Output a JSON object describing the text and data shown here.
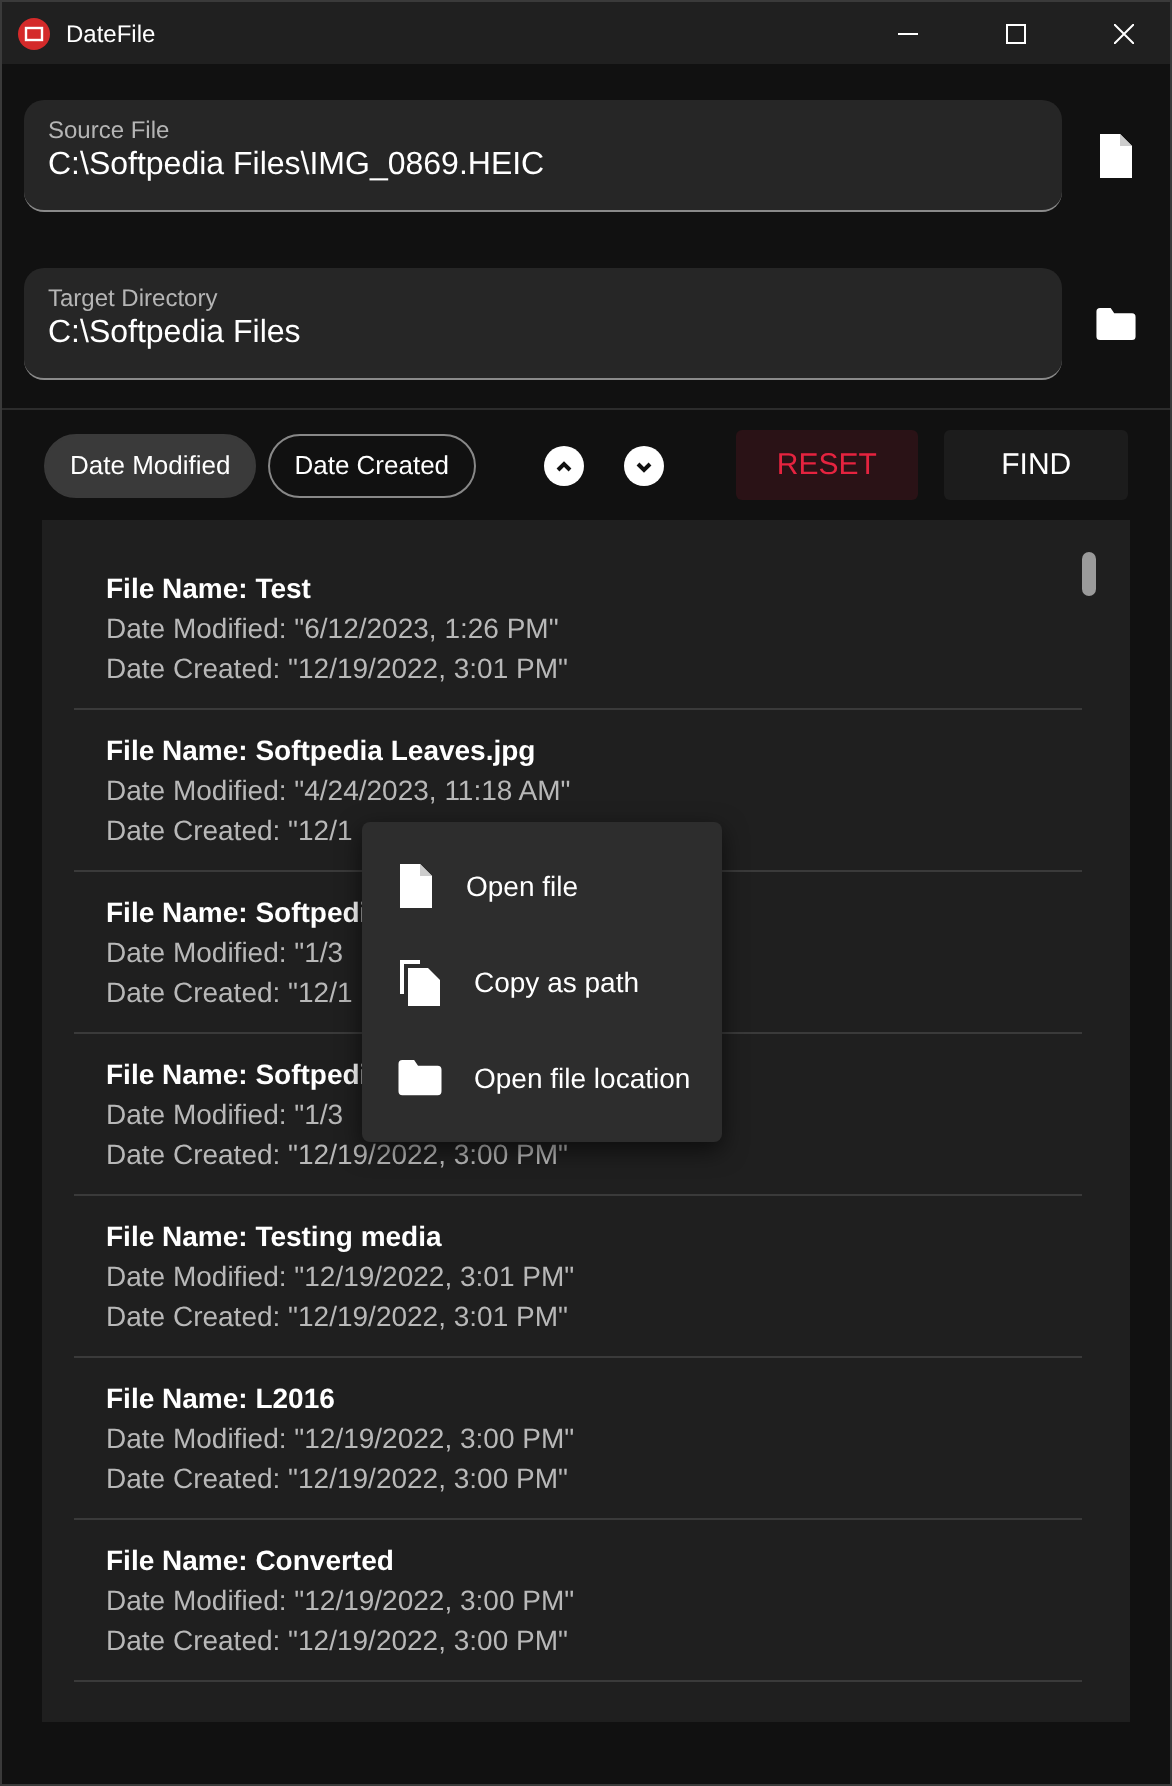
{
  "window": {
    "title": "DateFile"
  },
  "source": {
    "label": "Source File",
    "value": "C:\\Softpedia Files\\IMG_0869.HEIC"
  },
  "target": {
    "label": "Target Directory",
    "value": "C:\\Softpedia Files"
  },
  "sort_chips": [
    {
      "label": "Date Modified",
      "selected": true
    },
    {
      "label": "Date Created",
      "selected": false
    }
  ],
  "buttons": {
    "reset": "RESET",
    "find": "FIND"
  },
  "files": [
    {
      "name": "File Name: Test",
      "modified": "Date Modified: \"6/12/2023, 1:26 PM\"",
      "created": "Date Created: \"12/19/2022, 3:01 PM\""
    },
    {
      "name": "File Name: Softpedia Leaves.jpg",
      "modified": "Date Modified: \"4/24/2023, 11:18 AM\"",
      "created": "Date Created: \"12/1"
    },
    {
      "name": "File Name: Softpedi",
      "modified": "Date Modified: \"1/3",
      "created": "Date Created: \"12/1"
    },
    {
      "name": "File Name: Softpedi",
      "modified": "Date Modified: \"1/3",
      "created": "Date Created: \"12/19/2022, 3:00 PM\""
    },
    {
      "name": "File Name: Testing media",
      "modified": "Date Modified: \"12/19/2022, 3:01 PM\"",
      "created": "Date Created: \"12/19/2022, 3:01 PM\""
    },
    {
      "name": "File Name: L2016",
      "modified": "Date Modified: \"12/19/2022, 3:00 PM\"",
      "created": "Date Created: \"12/19/2022, 3:00 PM\""
    },
    {
      "name": "File Name: Converted",
      "modified": "Date Modified: \"12/19/2022, 3:00 PM\"",
      "created": "Date Created: \"12/19/2022, 3:00 PM\""
    }
  ],
  "context_menu": [
    {
      "kind": "file",
      "label": "Open file"
    },
    {
      "kind": "copy",
      "label": "Copy as path"
    },
    {
      "kind": "folder",
      "label": "Open file location"
    }
  ]
}
